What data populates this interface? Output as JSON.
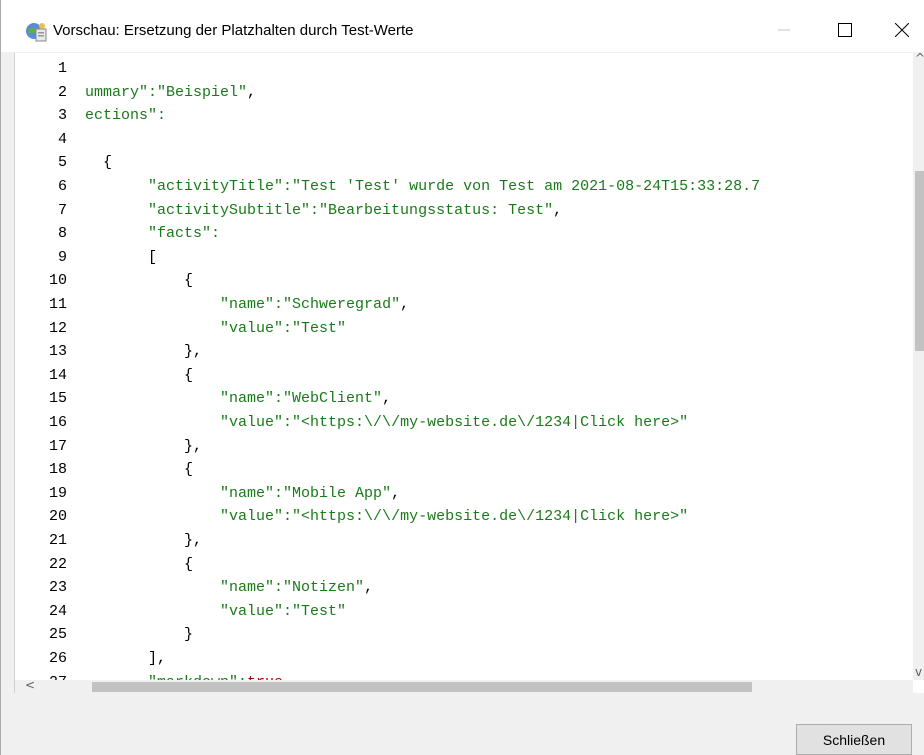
{
  "window": {
    "title": "Vorschau: Ersetzung der Platzhalten durch Test-Werte",
    "icon": "app-globe-icon"
  },
  "editor": {
    "lines": [
      {
        "n": "1",
        "segs": []
      },
      {
        "n": "2",
        "segs": [
          {
            "t": "ummary\":",
            "c": "s"
          },
          {
            "t": "\"Beispiel\"",
            "c": "s"
          },
          {
            "t": ",",
            "c": ""
          }
        ]
      },
      {
        "n": "3",
        "segs": [
          {
            "t": "ections\":",
            "c": "s"
          }
        ]
      },
      {
        "n": "4",
        "segs": []
      },
      {
        "n": "5",
        "segs": [
          {
            "t": "  {",
            "c": ""
          }
        ]
      },
      {
        "n": "6",
        "segs": [
          {
            "t": "       \"activityTitle\":",
            "c": "s"
          },
          {
            "t": "\"Test 'Test' wurde von Test am 2021-08-24T15:33:28.7",
            "c": "s"
          }
        ]
      },
      {
        "n": "7",
        "segs": [
          {
            "t": "       \"activitySubtitle\":",
            "c": "s"
          },
          {
            "t": "\"Bearbeitungsstatus: Test\"",
            "c": "s"
          },
          {
            "t": ",",
            "c": ""
          }
        ]
      },
      {
        "n": "8",
        "segs": [
          {
            "t": "       \"facts\":",
            "c": "s"
          }
        ]
      },
      {
        "n": "9",
        "segs": [
          {
            "t": "       [",
            "c": ""
          }
        ]
      },
      {
        "n": "10",
        "segs": [
          {
            "t": "           {",
            "c": ""
          }
        ]
      },
      {
        "n": "11",
        "segs": [
          {
            "t": "               \"name\":",
            "c": "s"
          },
          {
            "t": "\"Schweregrad\"",
            "c": "s"
          },
          {
            "t": ",",
            "c": ""
          }
        ]
      },
      {
        "n": "12",
        "segs": [
          {
            "t": "               \"value\":",
            "c": "s"
          },
          {
            "t": "\"Test\"",
            "c": "s"
          }
        ]
      },
      {
        "n": "13",
        "segs": [
          {
            "t": "           },",
            "c": ""
          }
        ]
      },
      {
        "n": "14",
        "segs": [
          {
            "t": "           {",
            "c": ""
          }
        ]
      },
      {
        "n": "15",
        "segs": [
          {
            "t": "               \"name\":",
            "c": "s"
          },
          {
            "t": "\"WebClient\"",
            "c": "s"
          },
          {
            "t": ",",
            "c": ""
          }
        ]
      },
      {
        "n": "16",
        "segs": [
          {
            "t": "               \"value\":",
            "c": "s"
          },
          {
            "t": "\"<https:\\/\\/my-website.de\\/1234|Click here>\"",
            "c": "s"
          }
        ]
      },
      {
        "n": "17",
        "segs": [
          {
            "t": "           },",
            "c": ""
          }
        ]
      },
      {
        "n": "18",
        "segs": [
          {
            "t": "           {",
            "c": ""
          }
        ]
      },
      {
        "n": "19",
        "segs": [
          {
            "t": "               \"name\":",
            "c": "s"
          },
          {
            "t": "\"Mobile App\"",
            "c": "s"
          },
          {
            "t": ",",
            "c": ""
          }
        ]
      },
      {
        "n": "20",
        "segs": [
          {
            "t": "               \"value\":",
            "c": "s"
          },
          {
            "t": "\"<https:\\/\\/my-website.de\\/1234|Click here>\"",
            "c": "s"
          }
        ]
      },
      {
        "n": "21",
        "segs": [
          {
            "t": "           },",
            "c": ""
          }
        ]
      },
      {
        "n": "22",
        "segs": [
          {
            "t": "           {",
            "c": ""
          }
        ]
      },
      {
        "n": "23",
        "segs": [
          {
            "t": "               \"name\":",
            "c": "s"
          },
          {
            "t": "\"Notizen\"",
            "c": "s"
          },
          {
            "t": ",",
            "c": ""
          }
        ]
      },
      {
        "n": "24",
        "segs": [
          {
            "t": "               \"value\":",
            "c": "s"
          },
          {
            "t": "\"Test\"",
            "c": "s"
          }
        ]
      },
      {
        "n": "25",
        "segs": [
          {
            "t": "           }",
            "c": ""
          }
        ]
      },
      {
        "n": "26",
        "segs": [
          {
            "t": "       ],",
            "c": ""
          }
        ]
      },
      {
        "n": "27",
        "segs": [
          {
            "t": "       \"markdown\":",
            "c": "s"
          },
          {
            "t": "true",
            "c": "k"
          }
        ]
      }
    ],
    "colors": {
      "string": "#1a7a1a",
      "keyword": "#b30000"
    }
  },
  "footer": {
    "close_label": "Schließen"
  }
}
